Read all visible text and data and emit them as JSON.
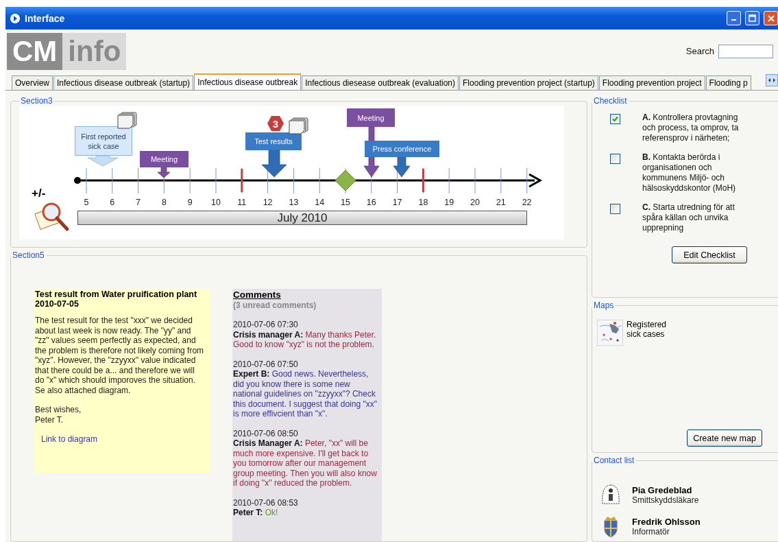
{
  "window": {
    "title": "Interface"
  },
  "logo": {
    "part_1": "CM",
    "part_2": "info"
  },
  "search": {
    "label": "Search"
  },
  "tabs": [
    {
      "label": "Overview",
      "selected": false
    },
    {
      "label": "Infectious disease outbreak (startup)",
      "selected": false
    },
    {
      "label": "Infectious disease outbreak",
      "selected": true
    },
    {
      "label": "Infectious diesease outbreak (evaluation)",
      "selected": false
    },
    {
      "label": "Flooding prevention project (startup)",
      "selected": false
    },
    {
      "label": "Flooding prevention project",
      "selected": false
    },
    {
      "label": "Flooding p",
      "selected": false
    }
  ],
  "section3": {
    "title": "Section3",
    "timeline": {
      "zoom_label": "+/-",
      "month": "July 2010",
      "ticks": [
        "5",
        "6",
        "7",
        "8",
        "9",
        "10",
        "11",
        "12",
        "13",
        "14",
        "15",
        "16",
        "17",
        "18",
        "19",
        "20",
        "21",
        "22"
      ],
      "events": [
        {
          "kind": "note",
          "label": "First reported sick case",
          "attachment": true
        },
        {
          "kind": "meeting",
          "label": "Meeting",
          "attachment": false
        },
        {
          "kind": "result",
          "label": "Test results",
          "attachment": true,
          "badge": "3"
        },
        {
          "kind": "meeting",
          "label": "Meeting",
          "attachment": false
        },
        {
          "kind": "result",
          "label": "Press conference",
          "attachment": false
        }
      ]
    }
  },
  "section5": {
    "title": "Section5",
    "note": {
      "title": "Test result from Water pruification plant 2010-07-05",
      "body": "The test result for the test \"xxx\" we decided about last week is now ready. The \"yy\" and \"zz\" values seem perfectly as expected, and the problem is therefore not likely coming from \"xyz\". However, the \"zzyyxx\" value indicated that there could be a... and therefore we will do \"x\" which should imporoves the situation. Se also attached diagram.",
      "greeting": "Best wishes,",
      "signature": "Peter T.",
      "link": "Link to  diagram"
    },
    "comments": {
      "title": "Comments",
      "unread": "(3 unread comments)",
      "items": [
        {
          "time": "2010-07-06 07:30",
          "author": "Crisis manager A:",
          "text": "Many thanks Peter. Good to know \"xyz\" is not the problem.",
          "color": "#a3283c"
        },
        {
          "time": "2010-07-06 07:50",
          "author": "Expert B:",
          "text": "Good news. Nevertheless, did you know there is some new national guidelines on \"zzyyxx\"? Check this document. I suggest that doing \"xx\" is more effivcient than \"x\".",
          "color": "#34349c"
        },
        {
          "time": "2010-07-06 08:50",
          "author": "Crisis Manager A:",
          "text": "Peter, \"xx\" will be much more expensive. I'll get back to you tomorrow after our management group meeting. Then you will also know if doing \"x\" reduced the problem.",
          "color": "#a3283c"
        },
        {
          "time": "2010-07-06 08:53",
          "author": "Peter T:",
          "text": "Ok!",
          "color": "#5a9a2a"
        }
      ]
    }
  },
  "checklist": {
    "title": "Checklist",
    "items": [
      {
        "text": "**A.** Kontrollera provtagning och process, ta omprov, ta referensprov i närheten;",
        "checked": true
      },
      {
        "text": "**B.** Kontakta berörda i organisationen och kommunens Miljö- och hälsoskyddskontor (MoH)",
        "checked": false
      },
      {
        "text": "**C.** Starta utredning för att spåra källan och unvika upprepning",
        "checked": false
      }
    ],
    "button": "Edit Checklist"
  },
  "maps": {
    "title": "Maps",
    "items": [
      {
        "label": "Registered sick cases"
      }
    ],
    "button": "Create new map"
  },
  "contacts": {
    "title": "Contact list",
    "items": [
      {
        "kind": "emblem",
        "name": "Pia Gredeblad",
        "role": "Smittskyddsläkare"
      },
      {
        "kind": "crest",
        "name": "Fredrik Ohlsson",
        "role": "Informatör"
      }
    ]
  }
}
